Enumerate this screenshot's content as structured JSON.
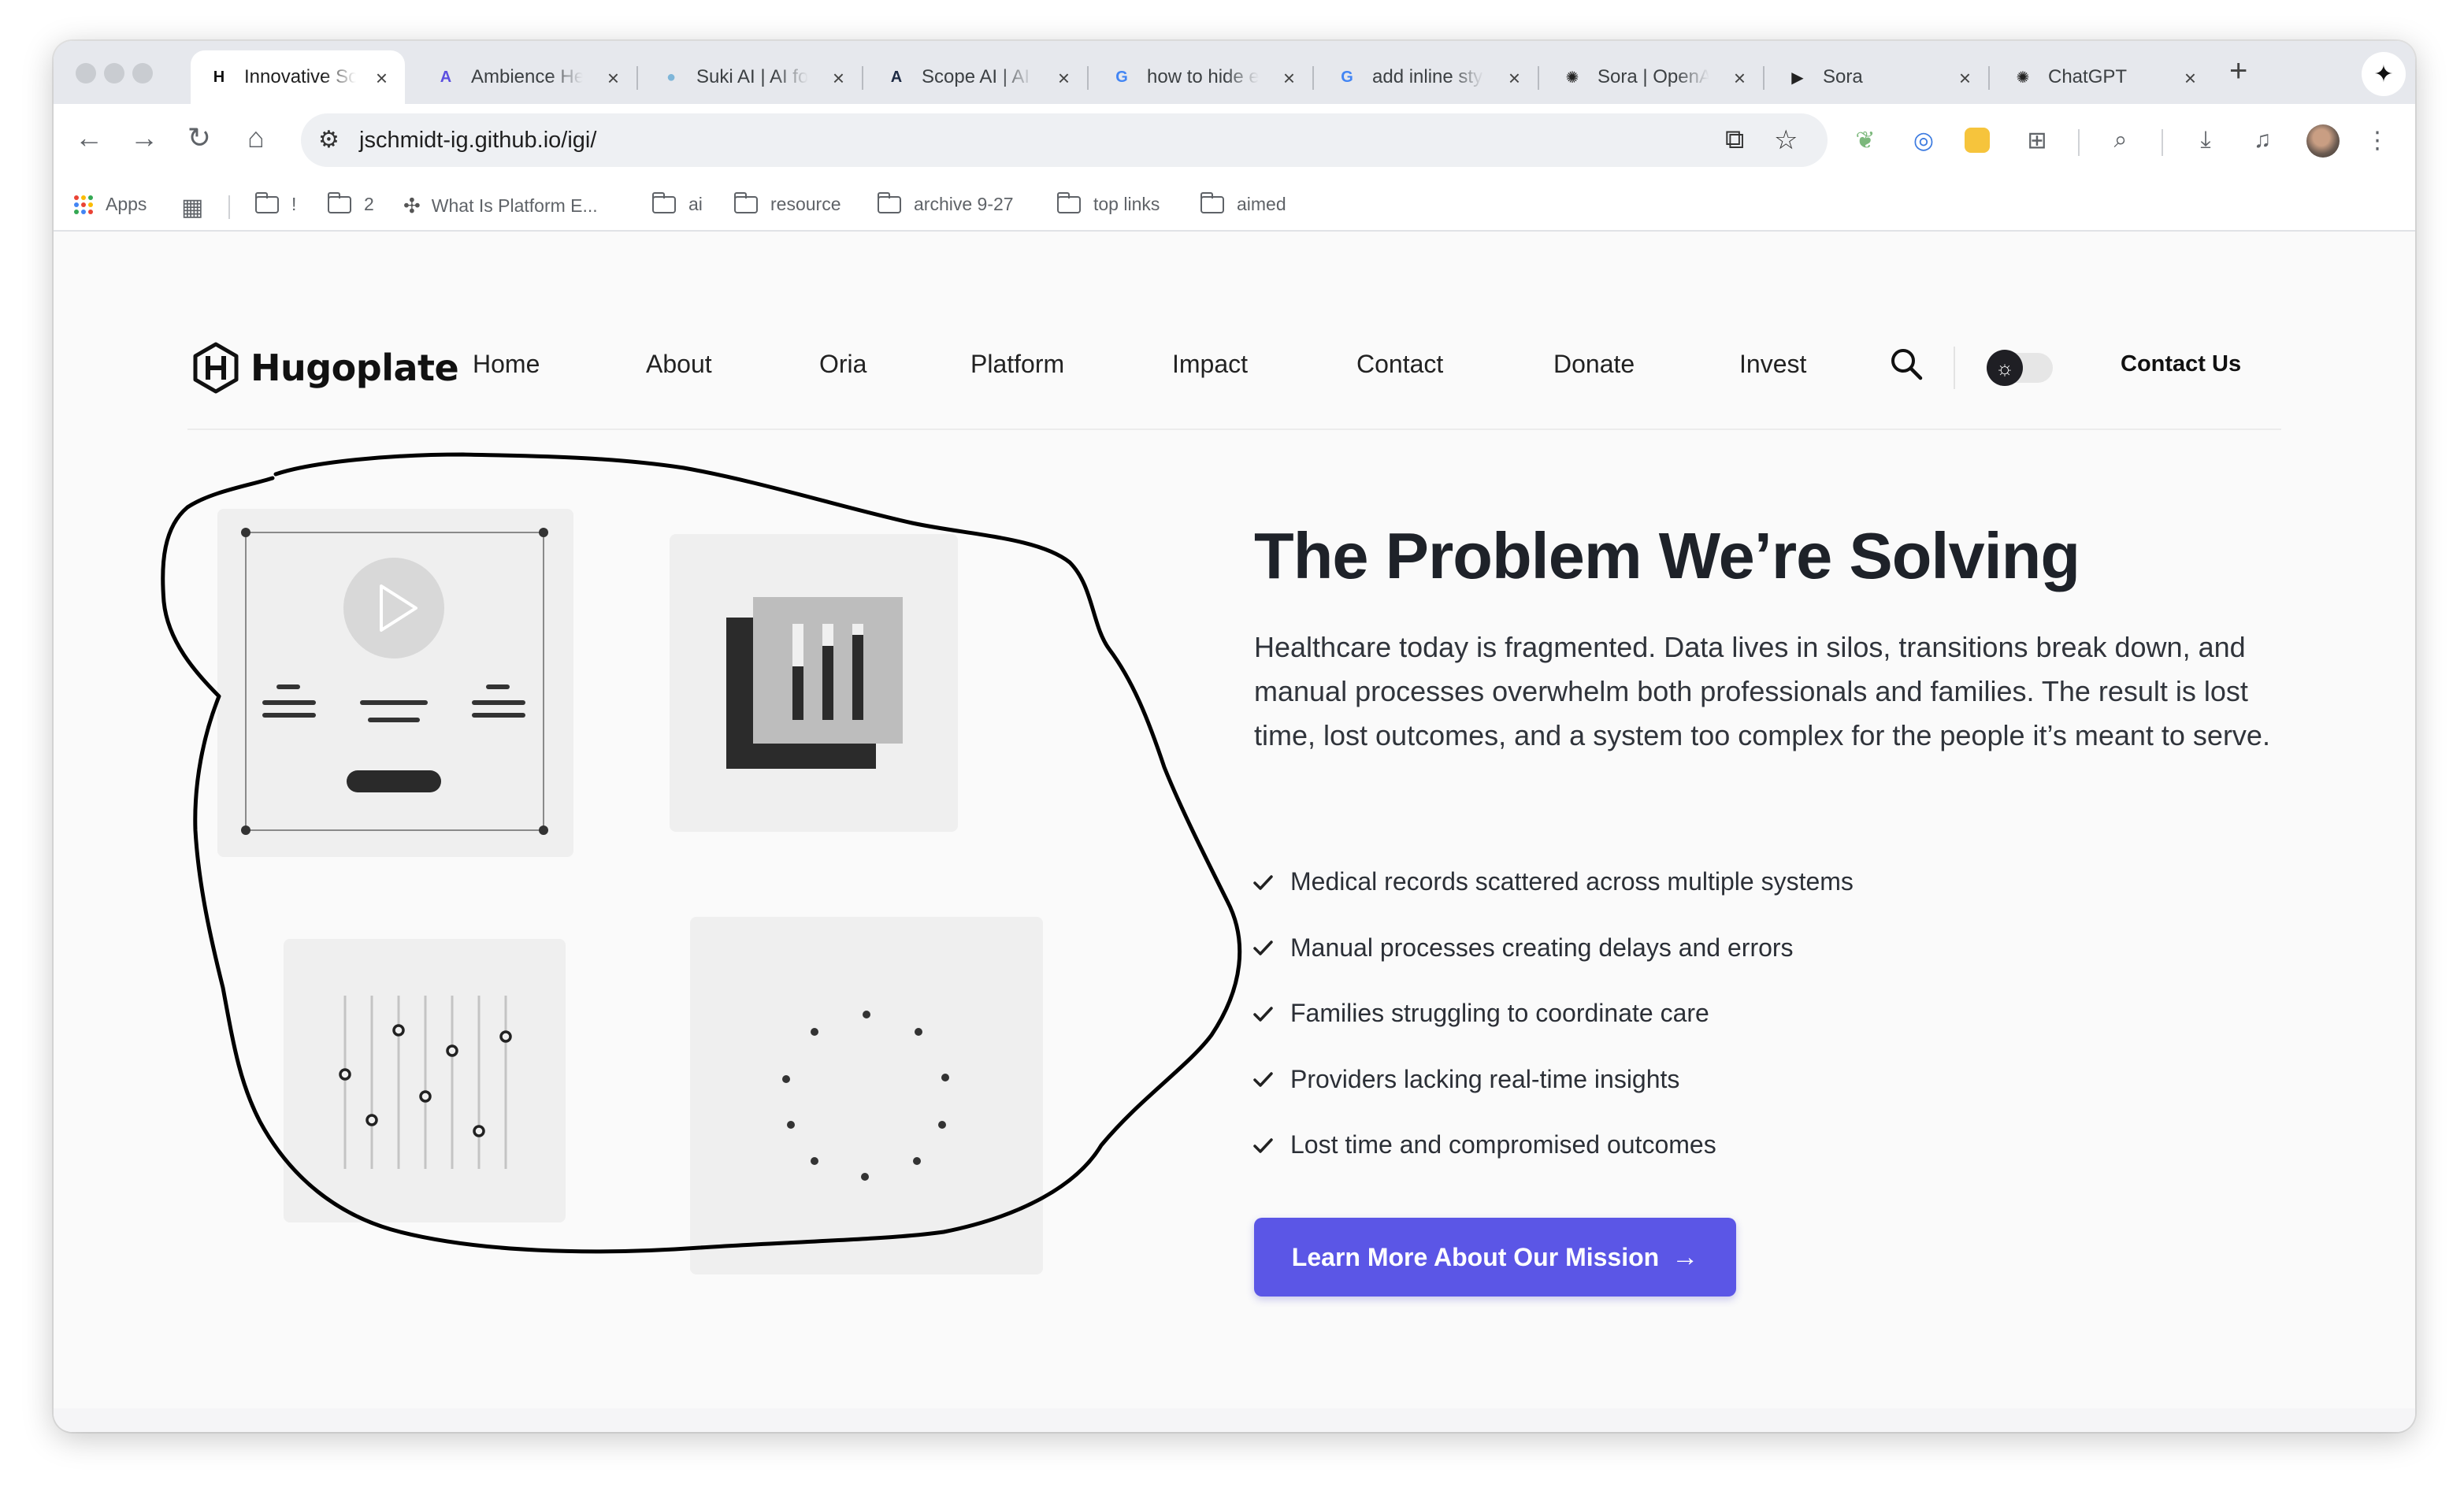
{
  "browser": {
    "tabs": [
      {
        "label": "Innovative Solutions",
        "active": true,
        "icon": "hugoplate-logo-icon",
        "icon_glyph": "H",
        "icon_color": "#111111"
      },
      {
        "label": "Ambience Healthcare",
        "icon": "ambience-icon",
        "icon_glyph": "A",
        "icon_color": "#5b4fe0"
      },
      {
        "label": "Suki AI | AI for Clinicians",
        "icon": "suki-icon",
        "icon_glyph": "●",
        "icon_color": "#7fb6d9"
      },
      {
        "label": "Scope AI | AI Scribe",
        "icon": "scope-icon",
        "icon_glyph": "A",
        "icon_color": "#1d2a44"
      },
      {
        "label": "how to hide elements",
        "icon": "google-icon",
        "icon_glyph": "G",
        "icon_color": "#4285f4"
      },
      {
        "label": "add inline style",
        "icon": "google-icon",
        "icon_glyph": "G",
        "icon_color": "#4285f4"
      },
      {
        "label": "Sora | OpenAI",
        "icon": "openai-icon",
        "icon_glyph": "✺",
        "icon_color": "#222222"
      },
      {
        "label": "Sora",
        "icon": "sora-icon",
        "icon_glyph": "▶",
        "icon_color": "#222222"
      },
      {
        "label": "ChatGPT",
        "icon": "openai-icon",
        "icon_glyph": "✺",
        "icon_color": "#222222"
      }
    ],
    "url": "jschmidt-ig.github.io/igi/",
    "bookmarks": [
      {
        "label": "Apps",
        "type": "apps"
      },
      {
        "label": "",
        "type": "grid"
      },
      {
        "label": "!",
        "type": "folder"
      },
      {
        "label": "2",
        "type": "folder"
      },
      {
        "label": "What Is Platform E...",
        "type": "site"
      },
      {
        "label": "ai",
        "type": "folder"
      },
      {
        "label": "resource",
        "type": "folder"
      },
      {
        "label": "archive 9-27",
        "type": "folder"
      },
      {
        "label": "top links",
        "type": "folder"
      },
      {
        "label": "aimed",
        "type": "folder"
      }
    ]
  },
  "site": {
    "logo": "Hugoplate",
    "nav": [
      "Home",
      "About",
      "Oria",
      "Platform",
      "Impact",
      "Contact",
      "Donate",
      "Invest"
    ],
    "contact_us": "Contact Us",
    "theme_toggle_on": false
  },
  "hero": {
    "title": "The Problem We’re Solving",
    "description": "Healthcare today is fragmented. Data lives in silos, transitions break down, and manual processes overwhelm both professionals and families. The result is lost time, lost outcomes, and a system too complex for the people it’s meant to serve.",
    "points": [
      "Medical records scattered across multiple systems",
      "Manual processes creating delays and errors",
      "Families struggling to coordinate care",
      "Providers lacking real-time insights",
      "Lost time and compromised outcomes"
    ],
    "cta_label": "Learn More About Our Mission",
    "cta_color": "#5b56e6",
    "illustrations": [
      "video-player-card",
      "bar-chart-card",
      "sliders-card",
      "loading-dots-card"
    ]
  }
}
